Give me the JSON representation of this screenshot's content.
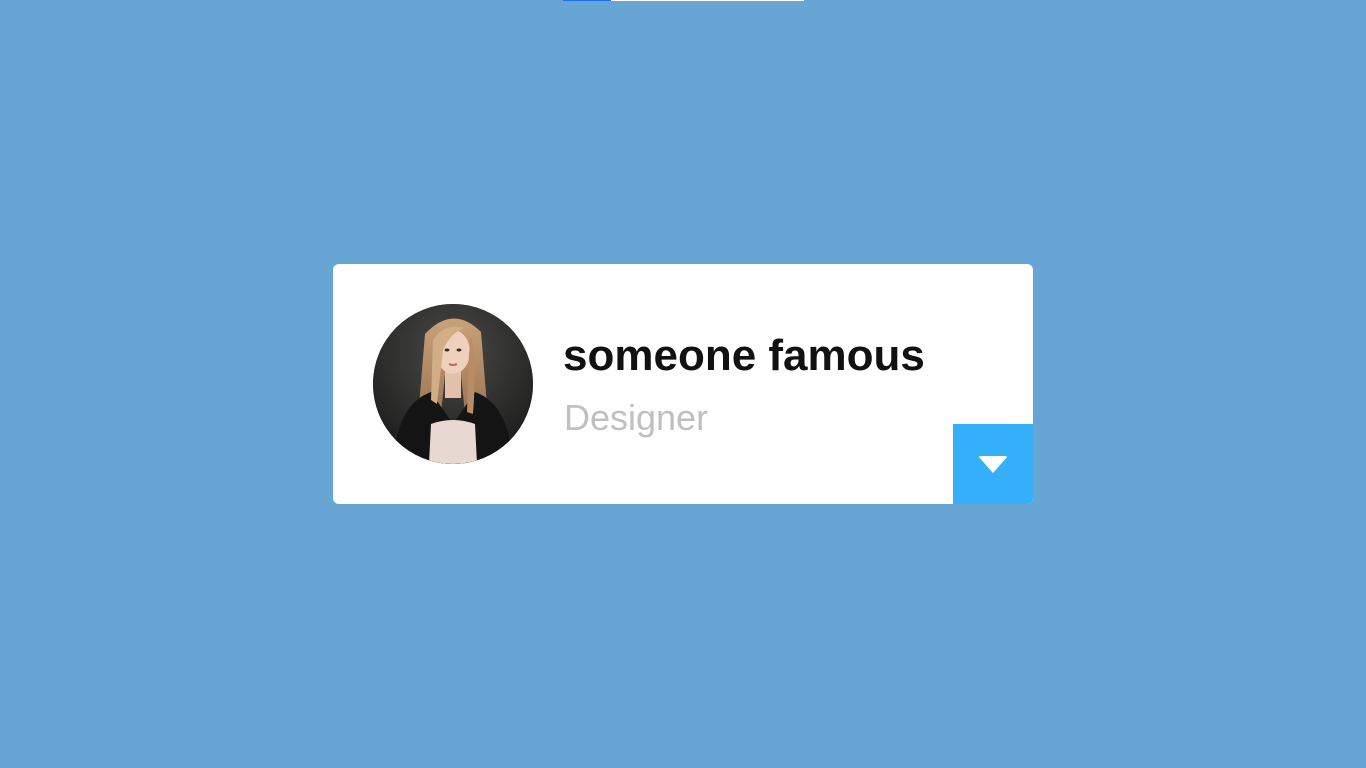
{
  "profile": {
    "name": "someone famous",
    "role": "Designer"
  },
  "icons": {
    "expand": "chevron-down-icon"
  },
  "colors": {
    "background": "#67a5d5",
    "card": "#ffffff",
    "accent": "#34b0fb",
    "name_text": "#111111",
    "role_text": "#c0c0c0"
  }
}
